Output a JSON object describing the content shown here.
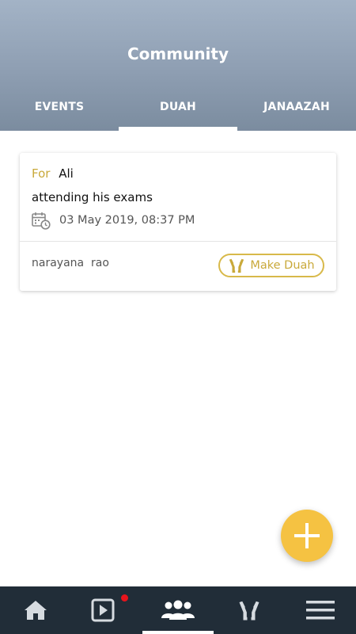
{
  "header": {
    "title": "Community",
    "tabs": [
      {
        "label": "EVENTS",
        "active": false
      },
      {
        "label": "DUAH",
        "active": true
      },
      {
        "label": "JANAAZAH",
        "active": false
      }
    ]
  },
  "duah_card": {
    "for_label": "For",
    "for_name": "Ali",
    "description": "attending his exams",
    "date": "03 May 2019, 08:37 PM",
    "author": "narayana  rao",
    "make_duah_label": "Make Duah"
  },
  "colors": {
    "header_top": "#a3b3c6",
    "header_bottom": "#7b8c9f",
    "accent_gold": "#c9a93a",
    "fab": "#f5c242",
    "bottom_nav": "#212d38",
    "notification_dot": "#e8141c"
  },
  "bottom_nav": {
    "items": [
      {
        "icon": "home-icon",
        "active": false
      },
      {
        "icon": "video-play-icon",
        "active": false,
        "has_notification": true
      },
      {
        "icon": "community-icon",
        "active": true
      },
      {
        "icon": "duah-hands-icon",
        "active": false
      },
      {
        "icon": "menu-icon",
        "active": false
      }
    ]
  },
  "fab": {
    "icon": "plus-icon"
  }
}
